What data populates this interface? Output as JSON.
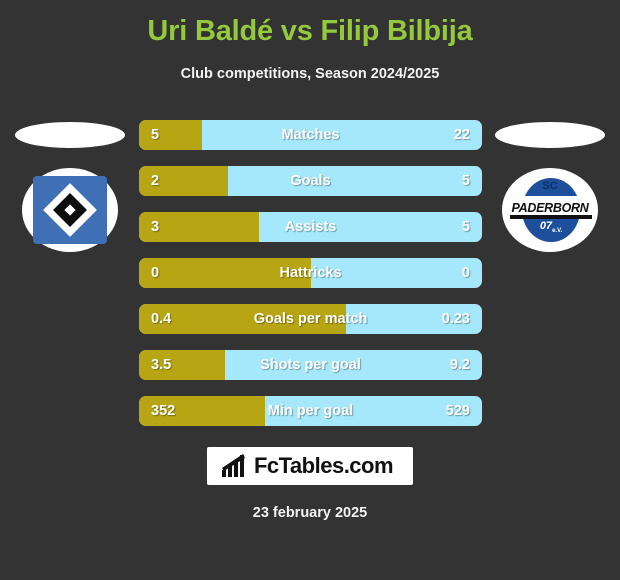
{
  "header": {
    "title": "Uri Baldé vs Filip Bilbija",
    "subtitle": "Club competitions, Season 2024/2025"
  },
  "teams": {
    "left": {
      "crest_name": "hamburger-sv-crest"
    },
    "right": {
      "crest_name": "sc-paderborn-crest",
      "line1": "SC",
      "line2": "PADERBORN",
      "line3": "07",
      "line3_suffix": "e.V."
    }
  },
  "chart_data": {
    "type": "bar",
    "title": "Uri Baldé vs Filip Bilbija",
    "subtitle": "Club competitions, Season 2024/2025",
    "orientation": "horizontal-diverging",
    "series": [
      {
        "name": "Uri Baldé",
        "color": "#b8a513",
        "values": [
          5,
          2,
          3,
          0,
          0.4,
          3.5,
          352
        ]
      },
      {
        "name": "Filip Bilbija",
        "color": "#a5e8fb",
        "values": [
          22,
          5,
          5,
          0,
          0.23,
          9.2,
          529
        ]
      }
    ],
    "categories": [
      "Matches",
      "Goals",
      "Assists",
      "Hattricks",
      "Goals per match",
      "Shots per goal",
      "Min per goal"
    ],
    "rows": [
      {
        "label": "Matches",
        "left": "5",
        "right": "22",
        "fill_pct": 18.5
      },
      {
        "label": "Goals",
        "left": "2",
        "right": "5",
        "fill_pct": 26.0
      },
      {
        "label": "Assists",
        "left": "3",
        "right": "5",
        "fill_pct": 35.0
      },
      {
        "label": "Hattricks",
        "left": "0",
        "right": "0",
        "fill_pct": 50.0
      },
      {
        "label": "Goals per match",
        "left": "0.4",
        "right": "0.23",
        "fill_pct": 60.3
      },
      {
        "label": "Shots per goal",
        "left": "3.5",
        "right": "9.2",
        "fill_pct": 25.1
      },
      {
        "label": "Min per goal",
        "left": "352",
        "right": "529",
        "fill_pct": 36.7
      }
    ]
  },
  "footer": {
    "logo_text": "FcTables.com",
    "logo_icon": "bar-chart-icon",
    "date": "23 february 2025"
  },
  "colors": {
    "background": "#333333",
    "title": "#95c93d",
    "left_bar": "#b8a513",
    "right_bar": "#a5e8fb",
    "text": "#ffffff"
  }
}
